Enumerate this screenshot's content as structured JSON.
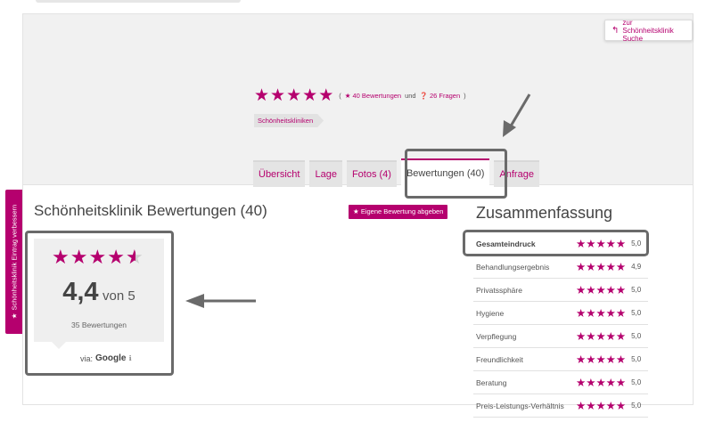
{
  "header": {
    "back_link": "zur Schönheitsklinik Suche",
    "back_icon": "reply-arrow-icon",
    "reviews_link": "40 Bewertungen",
    "connector": "und",
    "questions_link": "26 Fragen",
    "paren_open": "(",
    "paren_close": ")",
    "breadcrumb": "Schönheitskliniken",
    "rating_stars": 5
  },
  "tabs": [
    {
      "label": "Übersicht",
      "active": false
    },
    {
      "label": "Lage",
      "active": false
    },
    {
      "label": "Fotos (4)",
      "active": false
    },
    {
      "label": "Bewertungen (40)",
      "active": true
    },
    {
      "label": "Anfrage",
      "active": false
    }
  ],
  "side_tab": {
    "label": "Schönheitsklinik Eintrag verbessern"
  },
  "main": {
    "title": "Schönheitsklinik Bewertungen (40)",
    "own_review_button": "Eigene Bewertung abgeben"
  },
  "google": {
    "rating": 4.4,
    "score": "4,4",
    "out_of": "von 5",
    "count": "35 Bewertungen",
    "via_label": "via:",
    "via_source": "Google"
  },
  "summary": {
    "title": "Zusammenfassung",
    "rows": [
      {
        "label": "Gesamteindruck",
        "value": "5,0"
      },
      {
        "label": "Behandlungsergebnis",
        "value": "4,9"
      },
      {
        "label": "Privatssphäre",
        "value": "5,0"
      },
      {
        "label": "Hygiene",
        "value": "5,0"
      },
      {
        "label": "Verpflegung",
        "value": "5,0"
      },
      {
        "label": "Freundlichkeit",
        "value": "5,0"
      },
      {
        "label": "Beratung",
        "value": "5,0"
      },
      {
        "label": "Preis-Leistungs-Verhältnis",
        "value": "5,0"
      }
    ]
  },
  "colors": {
    "accent": "#b5006e",
    "annotation": "#6a6a6a",
    "hero_bg": "#f1f1f1"
  }
}
